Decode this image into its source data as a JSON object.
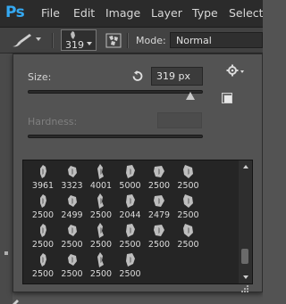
{
  "app": {
    "logo_text": "Ps",
    "logo_color": "#35a9f2"
  },
  "menu": {
    "items": [
      {
        "label": "File"
      },
      {
        "label": "Edit"
      },
      {
        "label": "Image"
      },
      {
        "label": "Layer"
      },
      {
        "label": "Type"
      },
      {
        "label": "Select"
      }
    ]
  },
  "options_bar": {
    "tool_icon": "brush-tool-icon",
    "brush_size": "319",
    "toggle_brush_panel_icon": "brush-panel-icon",
    "mode_label": "Mode:",
    "mode_value": "Normal"
  },
  "brush_picker": {
    "size_label": "Size:",
    "size_value": "319 px",
    "size_fraction": 0.93,
    "hardness_label": "Hardness:",
    "hardness_value": "",
    "hardness_enabled": false,
    "brushes": [
      {
        "size": "3961"
      },
      {
        "size": "3323"
      },
      {
        "size": "4001"
      },
      {
        "size": "5000"
      },
      {
        "size": "2500"
      },
      {
        "size": "2500"
      },
      {
        "size": "2500"
      },
      {
        "size": "2499"
      },
      {
        "size": "2500"
      },
      {
        "size": "2044"
      },
      {
        "size": "2479"
      },
      {
        "size": "2500"
      },
      {
        "size": "2500"
      },
      {
        "size": "2500"
      },
      {
        "size": "2500"
      },
      {
        "size": "2500"
      },
      {
        "size": "2500"
      },
      {
        "size": "2500"
      },
      {
        "size": "2500"
      },
      {
        "size": "2500"
      },
      {
        "size": "2500"
      },
      {
        "size": "2500"
      }
    ]
  },
  "colors": {
    "menubar_bg": "#2b2b2b",
    "panel_bg": "#535353",
    "grid_bg": "#252525",
    "text": "#dcdcdc",
    "text_disabled": "#7f7f7f"
  }
}
